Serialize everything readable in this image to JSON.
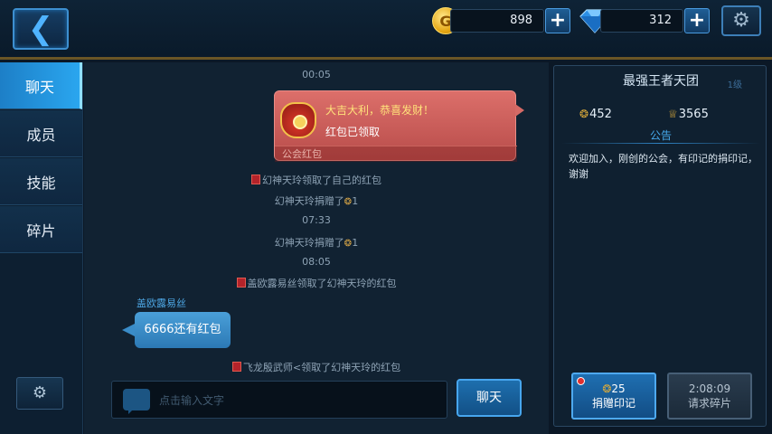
{
  "topbar": {
    "gold": "898",
    "gems": "312"
  },
  "nav": {
    "items": [
      "聊天",
      "成员",
      "技能",
      "碎片"
    ],
    "active_index": 0
  },
  "chat": {
    "lines": [
      {
        "text": "00:05"
      },
      {
        "text": "幻神天玲领取了自己的红包"
      },
      {
        "text": "幻神天玲捐赠了",
        "count": "1"
      },
      {
        "text": "07:33"
      },
      {
        "text": "幻神天玲捐赠了",
        "count": "1"
      },
      {
        "text": "08:05"
      },
      {
        "text": "盖欧露易丝领取了幻神天玲的红包"
      },
      {
        "text": "飞龙殷武师<领取了幻神天玲的红包"
      }
    ],
    "redpacket": {
      "title": "大吉大利，恭喜发财！",
      "status": "红包已领取",
      "footer": "公会红包"
    },
    "sender": "盖欧露易丝",
    "message": "6666还有红包",
    "input_placeholder": "点击输入文字",
    "send_label": "聊天"
  },
  "guild": {
    "name": "最强王者天团",
    "level": "1级",
    "emblem_count": "452",
    "trophy_count": "3565",
    "notice_title": "公告",
    "notice_text": "欢迎加入，刚创的公会，有印记的捐印记，谢谢",
    "donate_count": "25",
    "donate_label": "捐赠印记",
    "request_timer": "2:08:09",
    "request_label": "请求碎片"
  },
  "colors": {
    "accent": "#2aa6ef",
    "gold_border": "#6a5626",
    "redpacket": "#c85a56"
  }
}
